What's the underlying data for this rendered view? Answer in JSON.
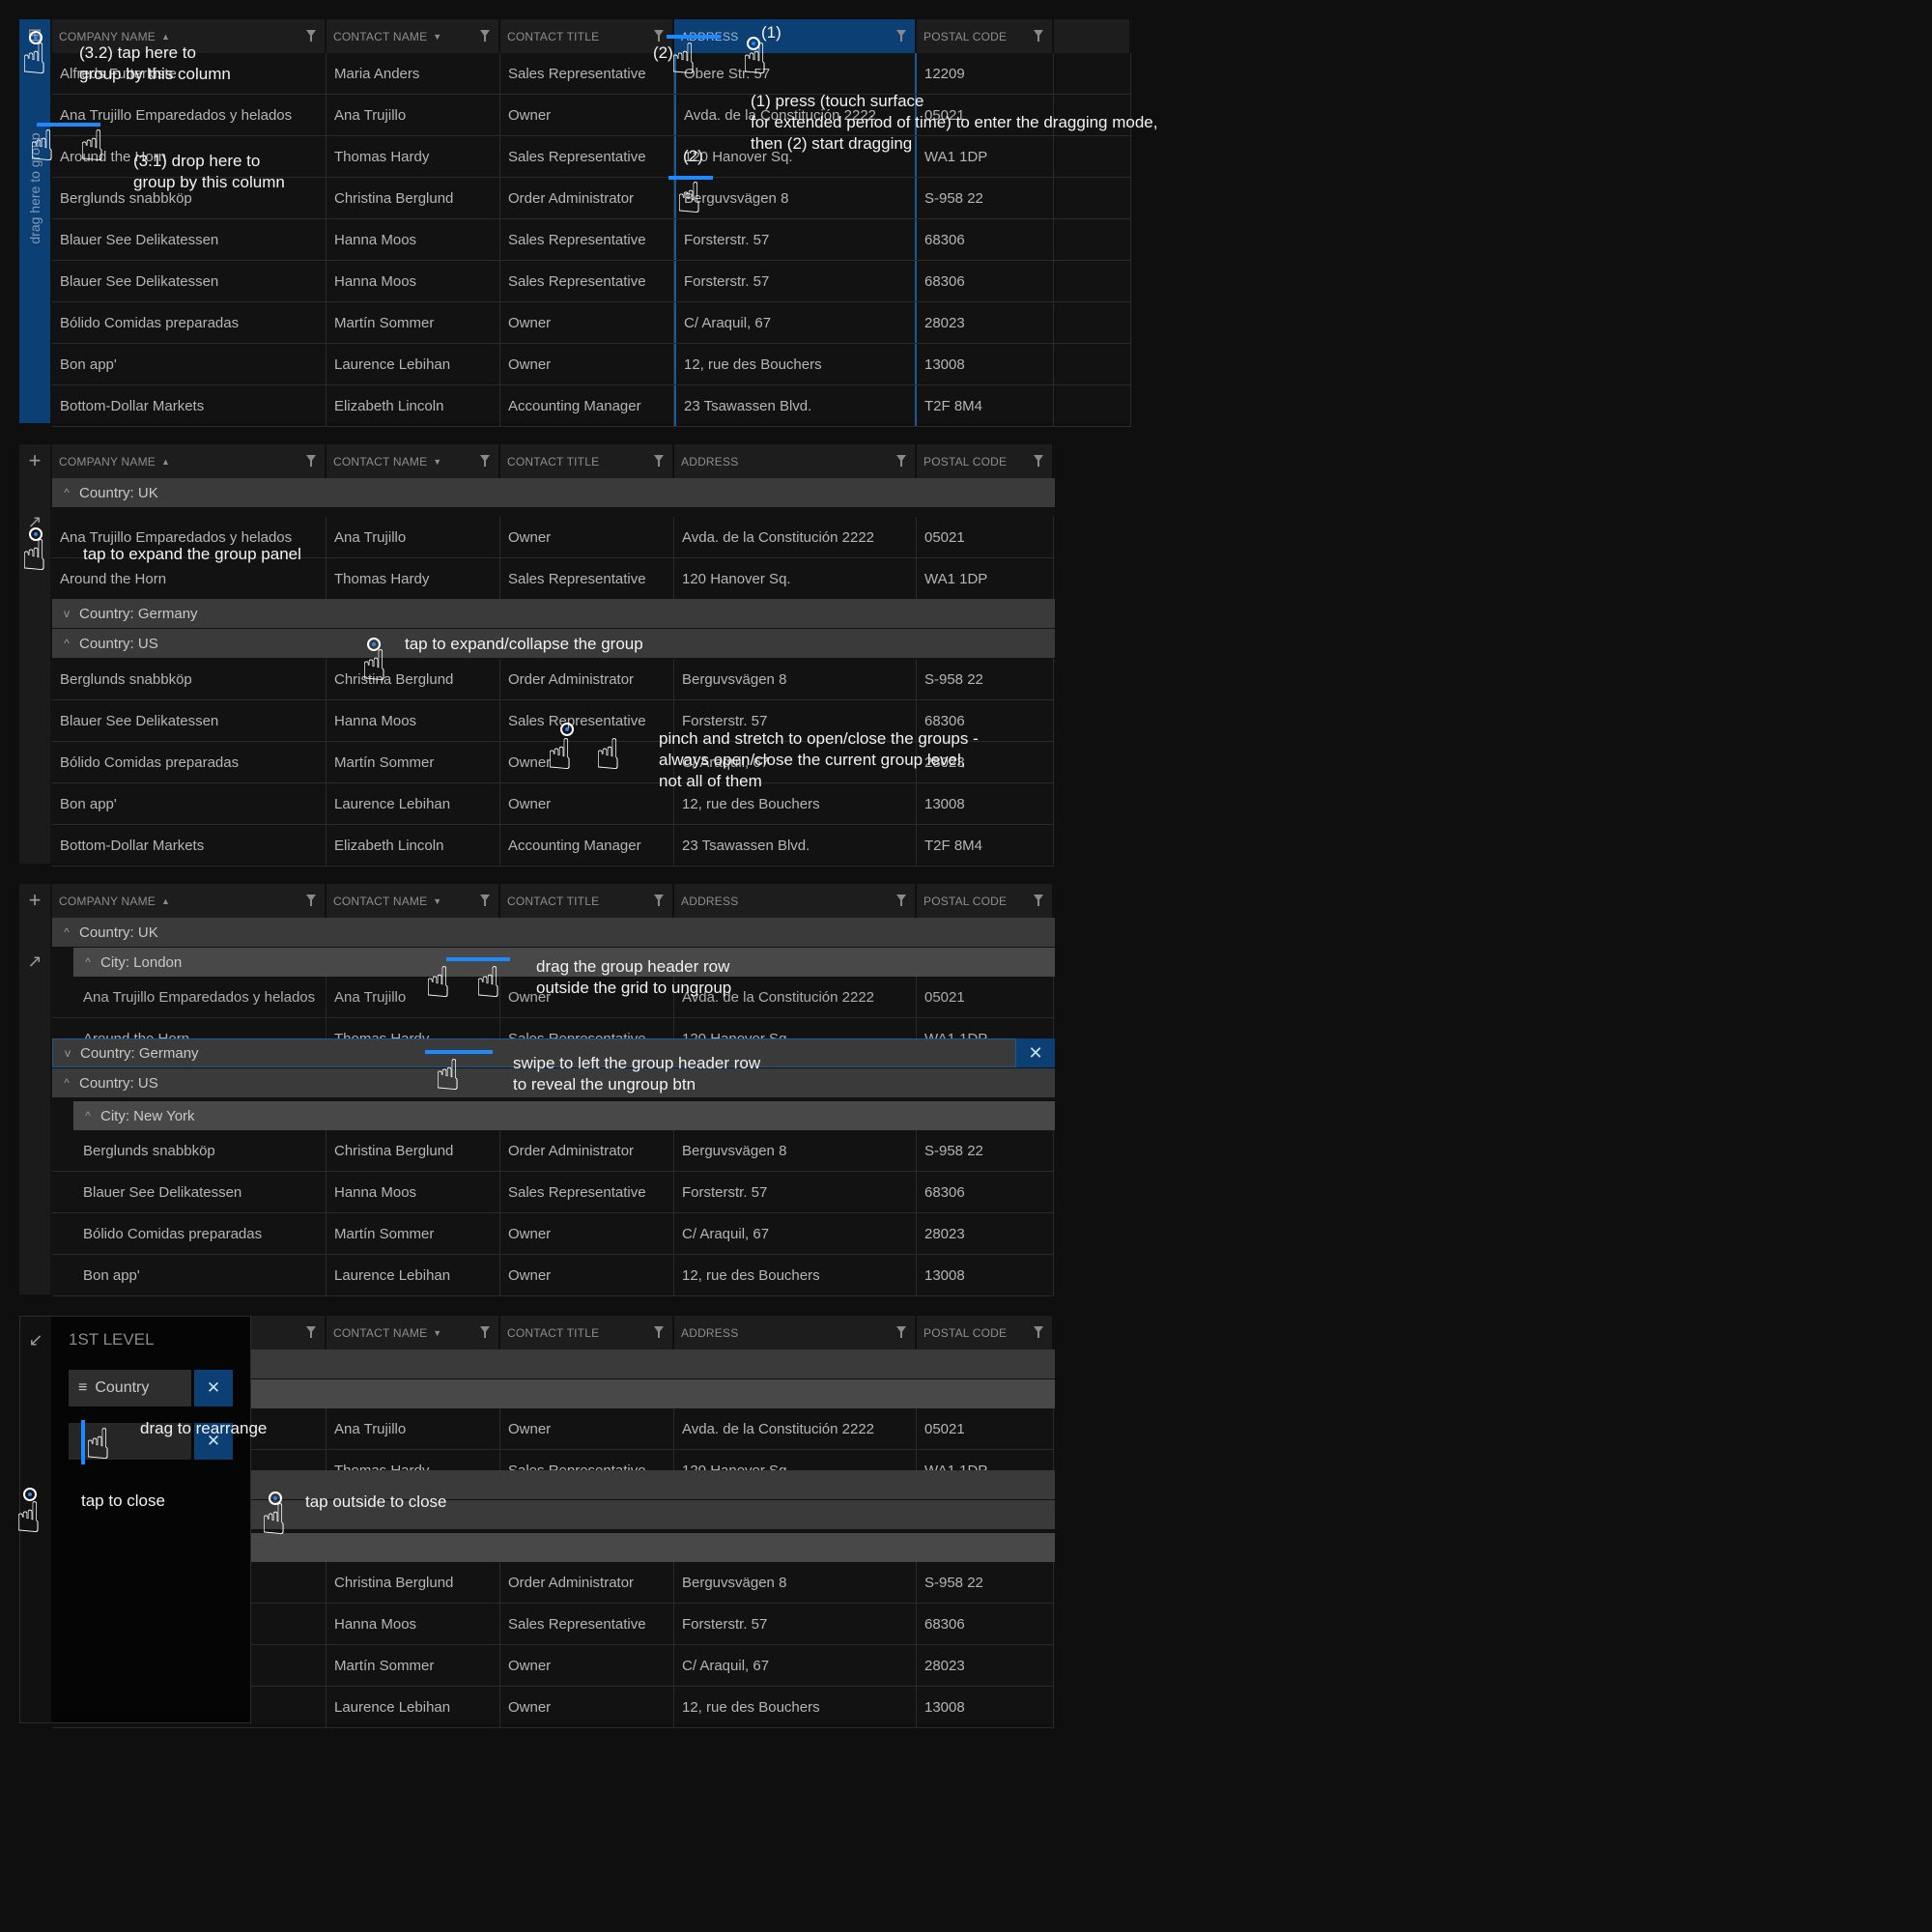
{
  "columns": [
    {
      "label": "COMPANY NAME",
      "sort": "▲"
    },
    {
      "label": "CONTACT NAME",
      "sort": "▼"
    },
    {
      "label": "CONTACT TITLE",
      "sort": ""
    },
    {
      "label": "ADDRESS",
      "sort": ""
    },
    {
      "label": "POSTAL CODE",
      "sort": ""
    }
  ],
  "sidebar": {
    "drag_text": "drag here to group",
    "add_icon": "+",
    "expand_icon": "↗",
    "collapse_icon": "↙",
    "group_panel_icon": "⊞"
  },
  "grid1": {
    "rows": [
      [
        "Alfreds Futterkiste",
        "Maria Anders",
        "Sales Representative",
        "Obere Str. 57",
        "12209"
      ],
      [
        "Ana Trujillo Emparedados y helados",
        "Ana Trujillo",
        "Owner",
        "Avda. de la Constitución 2222",
        "05021"
      ],
      [
        "Around the Horn",
        "Thomas Hardy",
        "Sales Representative",
        "120 Hanover Sq.",
        "WA1 1DP"
      ],
      [
        "Berglunds snabbköp",
        "Christina Berglund",
        "Order Administrator",
        "Berguvsvägen 8",
        "S-958 22"
      ],
      [
        "Blauer See Delikatessen",
        "Hanna Moos",
        "Sales Representative",
        "Forsterstr. 57",
        "68306"
      ],
      [
        "Blauer See Delikatessen",
        "Hanna Moos",
        "Sales Representative",
        "Forsterstr. 57",
        "68306"
      ],
      [
        "Bólido Comidas preparadas",
        "Martín Sommer",
        "Owner",
        "C/ Araquil, 67",
        "28023"
      ],
      [
        "Bon app'",
        "Laurence Lebihan",
        "Owner",
        "12, rue des Bouchers",
        "13008"
      ],
      [
        "Bottom-Dollar Markets",
        "Elizabeth Lincoln",
        "Accounting Manager",
        "23 Tsawassen Blvd.",
        "T2F 8M4"
      ]
    ]
  },
  "grid2": {
    "group_uk": "Country: UK",
    "uk_rows": [
      [
        "Ana Trujillo Emparedados y helados",
        "Ana Trujillo",
        "Owner",
        "Avda. de la Constitución 2222",
        "05021"
      ],
      [
        "Around the Horn",
        "Thomas Hardy",
        "Sales Representative",
        "120 Hanover Sq.",
        "WA1 1DP"
      ]
    ],
    "group_germany": "Country: Germany",
    "group_us": "Country: US",
    "us_rows": [
      [
        "Berglunds snabbköp",
        "Christina Berglund",
        "Order Administrator",
        "Berguvsvägen 8",
        "S-958 22"
      ],
      [
        "Blauer See Delikatessen",
        "Hanna Moos",
        "Sales Representative",
        "Forsterstr. 57",
        "68306"
      ],
      [
        "Bólido Comidas preparadas",
        "Martín Sommer",
        "Owner",
        "C/ Araquil, 67",
        "28023"
      ],
      [
        "Bon app'",
        "Laurence Lebihan",
        "Owner",
        "12, rue des Bouchers",
        "13008"
      ],
      [
        "Bottom-Dollar Markets",
        "Elizabeth Lincoln",
        "Accounting Manager",
        "23 Tsawassen Blvd.",
        "T2F 8M4"
      ]
    ]
  },
  "grid3": {
    "group_uk": "Country: UK",
    "group_london": "City: London",
    "london_rows": [
      [
        "Ana Trujillo Emparedados y helados",
        "Ana Trujillo",
        "Owner",
        "Avda. de la Constitución 2222",
        "05021"
      ],
      [
        "Around the Horn",
        "Thomas Hardy",
        "Sales Representative",
        "120 Hanover Sq.",
        "WA1 1DP"
      ]
    ],
    "group_germany": "Country: Germany",
    "group_us": "Country: US",
    "group_newyork": "City: New York",
    "ny_rows": [
      [
        "Berglunds snabbköp",
        "Christina Berglund",
        "Order Administrator",
        "Berguvsvägen 8",
        "S-958 22"
      ],
      [
        "Blauer See Delikatessen",
        "Hanna Moos",
        "Sales Representative",
        "Forsterstr. 57",
        "68306"
      ],
      [
        "Bólido Comidas preparadas",
        "Martín Sommer",
        "Owner",
        "C/ Araquil, 67",
        "28023"
      ],
      [
        "Bon app'",
        "Laurence Lebihan",
        "Owner",
        "12, rue des Bouchers",
        "13008"
      ]
    ],
    "ungroup_label": "✕"
  },
  "grid4": {
    "rows": [
      [
        "",
        "Ana Trujillo",
        "Owner",
        "Avda. de la Constitución 2222",
        "05021"
      ],
      [
        "",
        "Thomas Hardy",
        "Sales Representative",
        "120 Hanover Sq.",
        "WA1 1DP"
      ],
      [
        "",
        "Christina Berglund",
        "Order Administrator",
        "Berguvsvägen 8",
        "S-958 22"
      ],
      [
        "",
        "Hanna Moos",
        "Sales Representative",
        "Forsterstr. 57",
        "68306"
      ],
      [
        "",
        "Martín Sommer",
        "Owner",
        "C/ Araquil, 67",
        "28023"
      ],
      [
        "",
        "Laurence Lebihan",
        "Owner",
        "12, rue des Bouchers",
        "13008"
      ]
    ]
  },
  "group_panel": {
    "title": "1ST LEVEL",
    "chip1": "Country",
    "chip_close": "✕"
  },
  "annotations": {
    "tap_group": "(3.2) tap here to\ngroup by this column",
    "drop_group": "(3.1) drop here to\ngroup by this column",
    "press_drag": "(1) press (touch surface\nfor extended period of time) to enter the dragging mode,\nthen (2) start dragging",
    "step1": "(1)",
    "step2": "(2)",
    "expand_panel": "tap to expand the group panel",
    "expand_collapse": "tap to expand/collapse the group",
    "pinch": "pinch and stretch to open/close the groups -\nalways open/close the current group level,\nnot all of them",
    "drag_out": "drag the group header row\noutside the grid to ungroup",
    "swipe": "swipe to left the group header row\nto reveal the ungroup btn",
    "rearrange": "drag to rearrange",
    "tap_close": "tap to close",
    "tap_outside": "tap outside to close"
  }
}
